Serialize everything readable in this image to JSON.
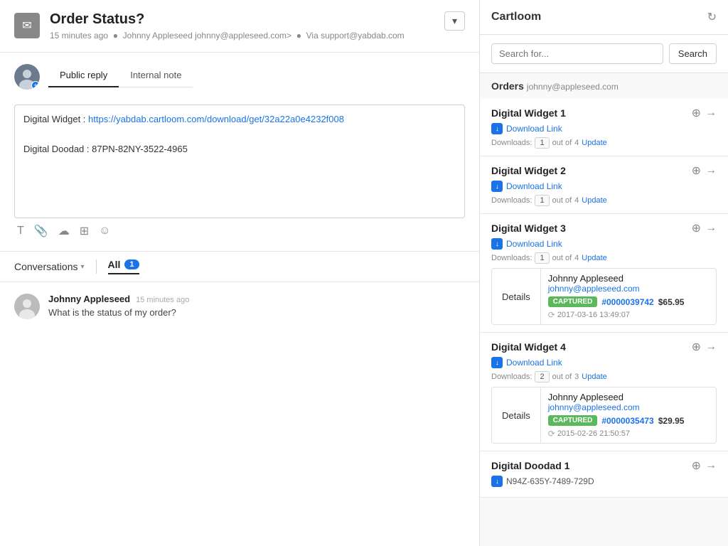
{
  "header": {
    "icon": "✉",
    "title": "Order Status?",
    "time": "15 minutes ago",
    "from": "Johnny Appleseed",
    "email": "johnny@appleseed.com>",
    "via": "Via support@yabdab.com",
    "dropdown_label": "▾"
  },
  "reply": {
    "tab_public": "Public reply",
    "tab_internal": "Internal note",
    "line1_label": "Digital Widget :",
    "line1_link": "https://yabdab.cartloom.com/download/get/32a22a0e4232f008",
    "line2_label": "Digital Doodad :",
    "line2_value": "87PN-82NY-3522-4965",
    "toolbar": {
      "t": "T",
      "paperclip": "📎",
      "cloud": "☁",
      "table": "⊞",
      "emoji": "☺"
    }
  },
  "conversations": {
    "label": "Conversations",
    "all_label": "All",
    "count": 1
  },
  "messages": [
    {
      "author": "Johnny Appleseed",
      "time": "15 minutes ago",
      "body": "What is the status of my order?"
    }
  ],
  "right": {
    "app_name": "Cartloom",
    "search_placeholder": "Search for...",
    "search_btn": "Search",
    "orders_label": "Orders",
    "orders_email": "johnny@appleseed.com",
    "items": [
      {
        "name": "Digital Widget 1",
        "type": "download",
        "download_label": "Download Link",
        "downloads_label": "Downloads:",
        "downloads_count": "1",
        "downloads_out_of": "out of",
        "downloads_max": "4",
        "update_label": "Update"
      },
      {
        "name": "Digital Widget 2",
        "type": "download",
        "download_label": "Download Link",
        "downloads_label": "Downloads:",
        "downloads_count": "1",
        "downloads_out_of": "out of",
        "downloads_max": "4",
        "update_label": "Update"
      },
      {
        "name": "Digital Widget 3",
        "type": "download",
        "download_label": "Download Link",
        "downloads_label": "Downloads:",
        "downloads_count": "1",
        "downloads_out_of": "out of",
        "downloads_max": "4",
        "update_label": "Update",
        "has_detail": true,
        "detail_name": "Johnny Appleseed",
        "detail_email": "johnny@appleseed.com",
        "detail_status": "CAPTURED",
        "detail_order_number": "#0000039742",
        "detail_amount": "$65.95",
        "detail_date": "2017-03-16 13:49:07"
      },
      {
        "name": "Digital Widget 4",
        "type": "download",
        "download_label": "Download Link",
        "downloads_label": "Downloads:",
        "downloads_count": "2",
        "downloads_out_of": "out of",
        "downloads_max": "3",
        "update_label": "Update",
        "has_detail": true,
        "detail_name": "Johnny Appleseed",
        "detail_email": "johnny@appleseed.com",
        "detail_status": "CAPTURED",
        "detail_order_number": "#0000035473",
        "detail_amount": "$29.95",
        "detail_date": "2015-02-26 21:50:57"
      },
      {
        "name": "Digital Doodad 1",
        "type": "key",
        "key_value": "N94Z-635Y-7489-729D"
      }
    ]
  }
}
